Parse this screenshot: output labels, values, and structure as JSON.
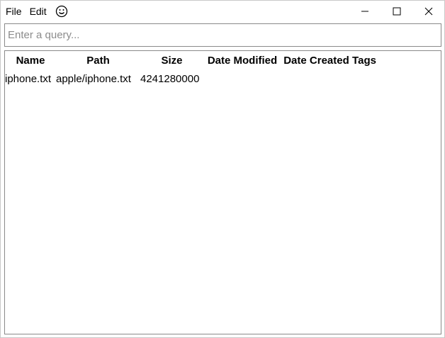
{
  "menu": {
    "file": "File",
    "edit": "Edit",
    "emoji_icon": "smiley-face-icon"
  },
  "window_controls": {
    "minimize_icon": "minimize-icon",
    "maximize_icon": "maximize-icon",
    "close_icon": "close-icon"
  },
  "search": {
    "placeholder": "Enter a query...",
    "value": ""
  },
  "table": {
    "columns": [
      "Name",
      "Path",
      "Size",
      "Date Modified",
      "Date Created",
      "Tags"
    ],
    "rows": [
      {
        "name": "iphone.txt",
        "path": "apple/iphone.txt",
        "size": "4241280000",
        "date_modified": "",
        "date_created": "",
        "tags": ""
      }
    ]
  }
}
